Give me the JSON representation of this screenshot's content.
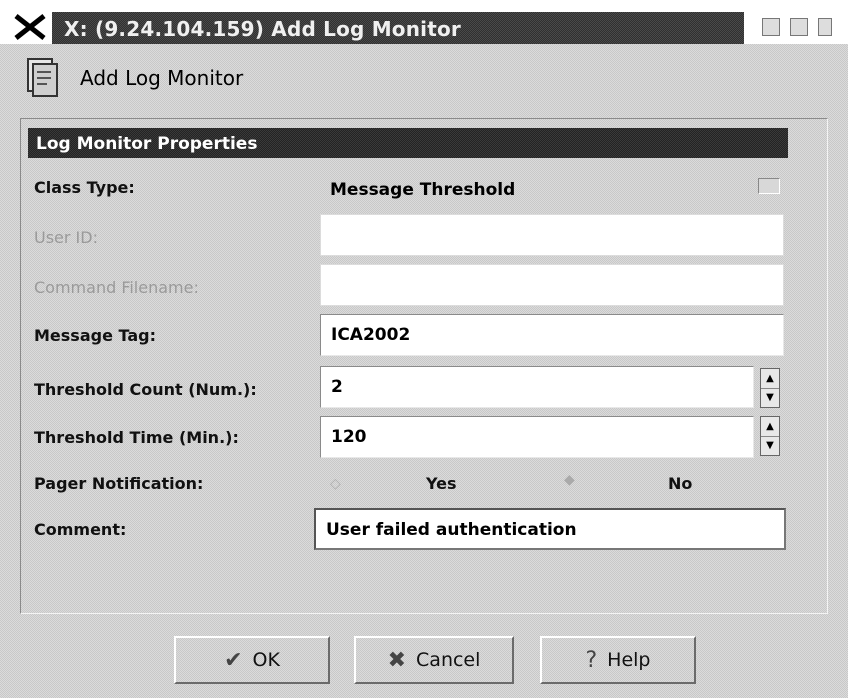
{
  "window": {
    "title": "X: (9.24.104.159) Add Log Monitor"
  },
  "dialog": {
    "heading": "Add Log Monitor",
    "heading_icon": "document-icon"
  },
  "panel": {
    "title": "Log Monitor Properties",
    "class_type": {
      "label": "Class Type:",
      "value": "Message Threshold"
    },
    "user_id": {
      "label": "User ID:",
      "value": ""
    },
    "command_filename": {
      "label": "Command Filename:",
      "value": ""
    },
    "message_tag": {
      "label": "Message Tag:",
      "value": "ICA2002"
    },
    "threshold_count": {
      "label": "Threshold Count (Num.):",
      "value": "2"
    },
    "threshold_time": {
      "label": "Threshold Time (Min.):",
      "value": "120"
    },
    "pager_notification": {
      "label": "Pager Notification:",
      "options": [
        "Yes",
        "No"
      ],
      "selected": "No"
    },
    "comment": {
      "label": "Comment:",
      "value": "User failed authentication"
    }
  },
  "buttons": {
    "ok": "OK",
    "cancel": "Cancel",
    "help": "Help"
  }
}
